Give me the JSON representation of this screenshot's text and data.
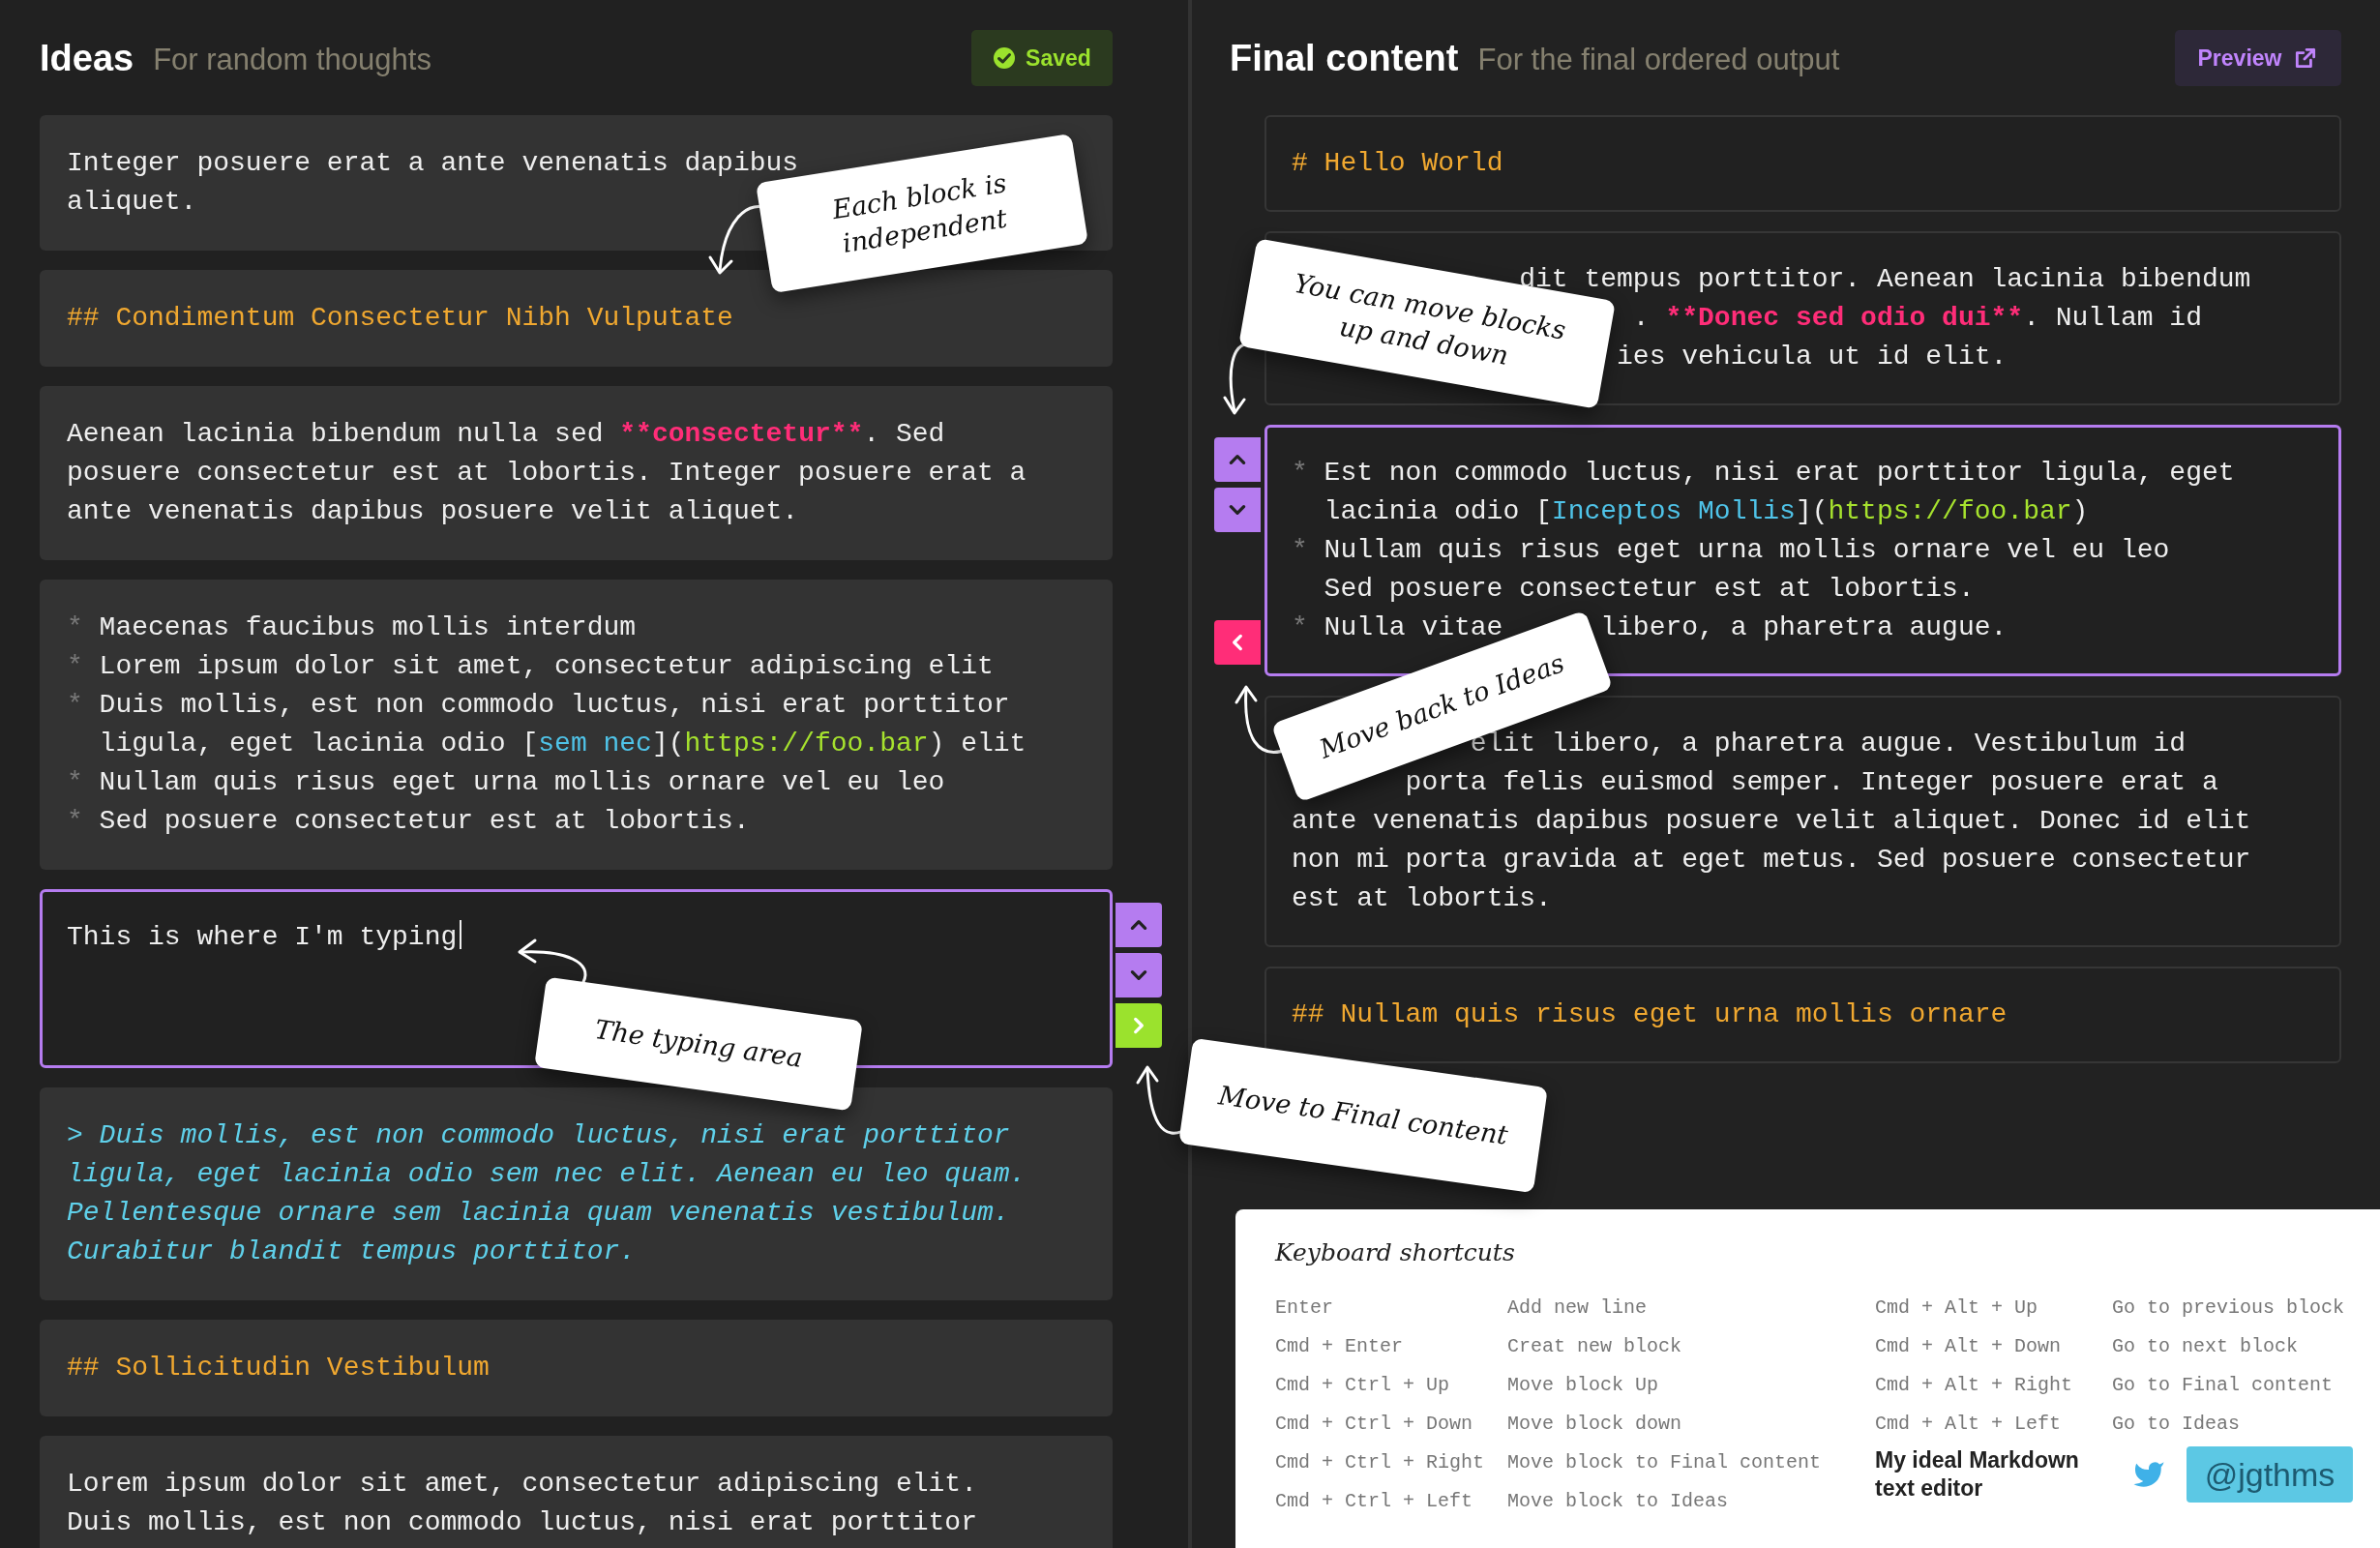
{
  "ideas": {
    "title": "Ideas",
    "subtitle": "For random thoughts",
    "status": {
      "kind": "saved",
      "label": "Saved"
    },
    "blocks": [
      {
        "kind": "paragraph",
        "selected": false,
        "lines": [
          {
            "segments": [
              "Integer posuere erat a ante venenatis dapibus"
            ]
          },
          {
            "segments": [
              "aliquet."
            ]
          }
        ]
      },
      {
        "kind": "heading",
        "selected": false,
        "lines": [
          {
            "segments": [
              "## Condimentum Consectetur Nibh Vulputate"
            ]
          }
        ]
      },
      {
        "kind": "paragraph",
        "selected": false,
        "lines": [
          {
            "segments": [
              "Aenean lacinia bibendum nulla sed ",
              {
                "text": "**consectetur**",
                "kind": "strong"
              },
              ". Sed"
            ]
          },
          {
            "segments": [
              "posuere consectetur est at lobortis. Integer posuere erat a"
            ]
          },
          {
            "segments": [
              "ante venenatis dapibus posuere velit aliquet."
            ]
          }
        ]
      },
      {
        "kind": "list",
        "selected": false,
        "lines": [
          {
            "marker": "*",
            "segments": [
              "Maecenas faucibus mollis interdum"
            ]
          },
          {
            "marker": "*",
            "segments": [
              "Lorem ipsum dolor sit amet, consectetur adipiscing elit"
            ]
          },
          {
            "marker": "*",
            "segments": [
              "Duis mollis, est non commodo luctus, nisi erat porttitor"
            ]
          },
          {
            "segments": [
              "ligula, eget lacinia odio [",
              {
                "text": "sem nec",
                "kind": "link"
              },
              "](",
              {
                "text": "https://foo.bar",
                "kind": "url"
              },
              ") elit"
            ]
          },
          {
            "marker": "*",
            "segments": [
              "Nullam quis risus eget urna mollis ornare vel eu leo"
            ]
          },
          {
            "marker": "*",
            "segments": [
              "Sed posuere consectetur est at lobortis."
            ]
          }
        ]
      },
      {
        "kind": "editor",
        "selected": true,
        "value": "This is where I'm typing"
      },
      {
        "kind": "quote",
        "selected": false,
        "lines": [
          {
            "segments": [
              "> Duis mollis, est non commodo luctus, nisi erat porttitor"
            ]
          },
          {
            "segments": [
              "ligula, eget lacinia odio sem nec elit. Aenean eu leo quam."
            ]
          },
          {
            "segments": [
              "Pellentesque ornare sem lacinia quam venenatis vestibulum."
            ]
          },
          {
            "segments": [
              "Curabitur blandit tempus porttitor."
            ]
          }
        ]
      },
      {
        "kind": "heading",
        "selected": false,
        "lines": [
          {
            "segments": [
              "## Sollicitudin Vestibulum"
            ]
          }
        ]
      },
      {
        "kind": "paragraph",
        "selected": false,
        "lines": [
          {
            "segments": [
              "Lorem ipsum dolor sit amet, consectetur adipiscing elit."
            ]
          },
          {
            "segments": [
              "Duis mollis, est non commodo luctus, nisi erat porttitor"
            ]
          }
        ]
      }
    ]
  },
  "final": {
    "title": "Final content",
    "subtitle": "For the final ordered output",
    "action": {
      "label": "Preview"
    },
    "blocks": [
      {
        "kind": "heading",
        "selected": false,
        "lines": [
          {
            "segments": [
              "# Hello World"
            ]
          }
        ]
      },
      {
        "kind": "paragraph",
        "selected": false,
        "lines": [
          {
            "segments": [
              "dit tempus porttitor. Aenean lacinia bibendum"
            ]
          },
          {
            "segments": [
              ". ",
              {
                "text": "**Donec sed odio dui**",
                "kind": "strong"
              },
              ". Nullam id"
            ]
          },
          {
            "segments": [
              "ies vehicula ut id elit."
            ]
          }
        ]
      },
      {
        "kind": "list",
        "selected": true,
        "lines": [
          {
            "marker": "*",
            "segments": [
              "Est non commodo luctus, nisi erat porttitor ligula, eget"
            ]
          },
          {
            "segments": [
              "lacinia odio [",
              {
                "text": "Inceptos Mollis",
                "kind": "link"
              },
              "](",
              {
                "text": "https://foo.bar",
                "kind": "url"
              },
              ")"
            ]
          },
          {
            "marker": "*",
            "segments": [
              "Nullam quis risus eget urna mollis ornare vel eu leo"
            ]
          },
          {
            "segments": [
              "Sed posuere consectetur est at lobortis."
            ]
          },
          {
            "marker": "*",
            "segments": [
              "Nulla vitae",
              "libero, a pharetra augue."
            ]
          }
        ]
      },
      {
        "kind": "paragraph",
        "selected": false,
        "lines": [
          {
            "segments": [
              "elit libero, a pharetra augue. Vestibulum id"
            ]
          },
          {
            "segments": [
              "porta felis euismod semper. Integer posuere erat a"
            ]
          },
          {
            "segments": [
              "ante venenatis dapibus posuere velit aliquet. Donec id elit"
            ]
          },
          {
            "segments": [
              "non mi porta gravida at eget metus. Sed posuere consectetur"
            ]
          },
          {
            "segments": [
              "est at lobortis."
            ]
          }
        ]
      },
      {
        "kind": "heading",
        "selected": false,
        "lines": [
          {
            "segments": [
              "## Nullam quis risus eget urna mollis ornare"
            ]
          }
        ]
      }
    ]
  },
  "notes": [
    {
      "text": "Each block is independent"
    },
    {
      "text": "You can move blocks up and down"
    },
    {
      "text": "Move back to Ideas"
    },
    {
      "text": "The typing area"
    },
    {
      "text": "Move to Final content"
    }
  ],
  "shortcuts": {
    "title": "Keyboard shortcuts",
    "columns": [
      [
        {
          "keys": "Enter",
          "action": "Add new line"
        },
        {
          "keys": "Cmd + Enter",
          "action": "Creat new block"
        },
        {
          "keys": "Cmd + Ctrl + Up",
          "action": "Move block Up"
        },
        {
          "keys": "Cmd + Ctrl + Down",
          "action": "Move block down"
        },
        {
          "keys": "Cmd + Ctrl + Right",
          "action": "Move block to Final content"
        },
        {
          "keys": "Cmd + Ctrl + Left",
          "action": "Move block to Ideas"
        }
      ],
      [
        {
          "keys": "Cmd + Alt + Up",
          "action": "Go to previous block"
        },
        {
          "keys": "Cmd + Alt + Down",
          "action": "Go to next block"
        },
        {
          "keys": "Cmd + Alt + Right",
          "action": "Go to Final content"
        },
        {
          "keys": "Cmd + Alt + Left",
          "action": "Go to Ideas"
        }
      ]
    ],
    "footer": {
      "tagline": "My ideal Markdown text editor",
      "handle": "@jgthms"
    }
  }
}
